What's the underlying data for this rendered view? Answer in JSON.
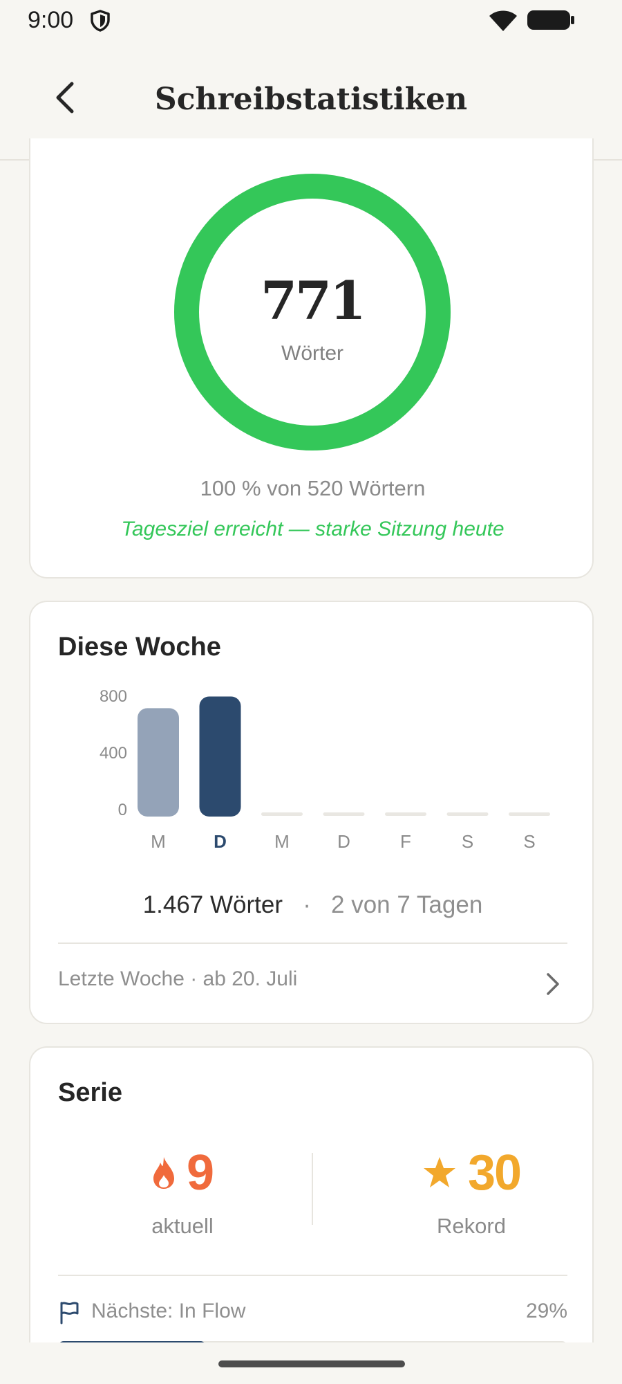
{
  "status_bar": {
    "time": "9:00"
  },
  "app_bar": {
    "title": "Schreibstatistiken"
  },
  "goal": {
    "words_today": "771",
    "unit": "Wörter",
    "progress_text": "100 % von 520 Wörtern",
    "progress_fraction": 1.0,
    "message": "Tagesziel erreicht — starke Sitzung heute",
    "ring_color": "#34c759"
  },
  "week": {
    "title": "Diese Woche",
    "total": "1.467 Wörter",
    "separator": "·",
    "days_text": "2 von 7 Tagen",
    "last_week_label": "Letzte Woche · ab 20. Juli"
  },
  "chart_data": {
    "type": "bar",
    "categories": [
      "M",
      "D",
      "M",
      "D",
      "F",
      "S",
      "S"
    ],
    "values": [
      696,
      771,
      0,
      0,
      0,
      0,
      0
    ],
    "highlight_index": 1,
    "yticks": [
      "800",
      "400",
      "0"
    ],
    "ylim": [
      0,
      800
    ],
    "colors": {
      "default": "#94a3b8",
      "highlight": "#2c4a6e",
      "empty": "#e9e7e2"
    }
  },
  "streak": {
    "title": "Serie",
    "current_value": "9",
    "current_label": "aktuell",
    "best_value": "30",
    "best_label": "Rekord",
    "next_label": "Nächste: In Flow",
    "next_percent": "29%",
    "next_fraction": 0.29,
    "colors": {
      "current": "#f06a3c",
      "best": "#f2a82c",
      "progress": "#2c4a6e"
    }
  }
}
